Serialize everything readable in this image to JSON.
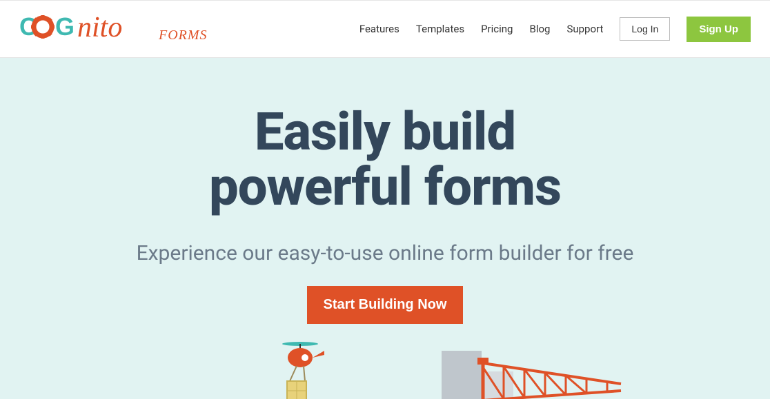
{
  "logo": {
    "forms_text": "FORMS"
  },
  "nav": {
    "items": [
      {
        "label": "Features"
      },
      {
        "label": "Templates"
      },
      {
        "label": "Pricing"
      },
      {
        "label": "Blog"
      },
      {
        "label": "Support"
      }
    ],
    "login": "Log In",
    "signup": "Sign Up"
  },
  "hero": {
    "title_line1": "Easily build",
    "title_line2": "powerful forms",
    "subtitle": "Experience our easy-to-use online form builder for free",
    "cta": "Start Building Now"
  }
}
